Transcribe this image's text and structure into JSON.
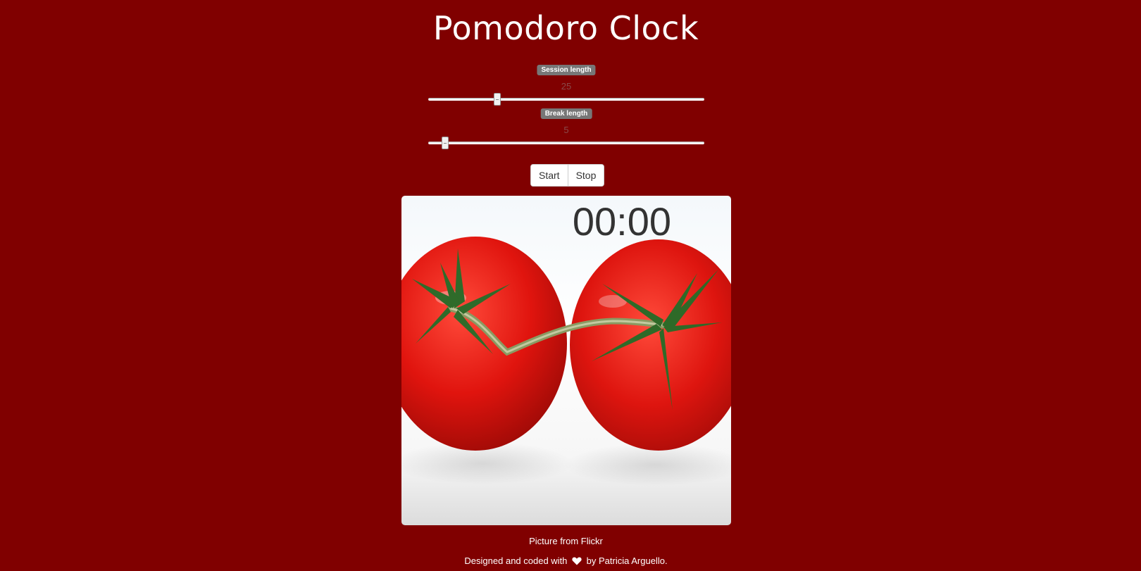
{
  "header": {
    "title": "Pomodoro Clock"
  },
  "session": {
    "label": "Session length",
    "value": "25",
    "fraction": 0.25
  },
  "break": {
    "label": "Break length",
    "value": "5",
    "fraction": 0.06
  },
  "controls": {
    "start_label": "Start",
    "stop_label": "Stop"
  },
  "timer": {
    "display": "00:00"
  },
  "footer": {
    "credit": "Picture from Flickr",
    "prefix": "Designed and coded with",
    "suffix": "by Patricia Arguello.",
    "heart_icon": "heart-icon"
  },
  "colors": {
    "background": "#800000",
    "tomato": "#d8120d"
  }
}
